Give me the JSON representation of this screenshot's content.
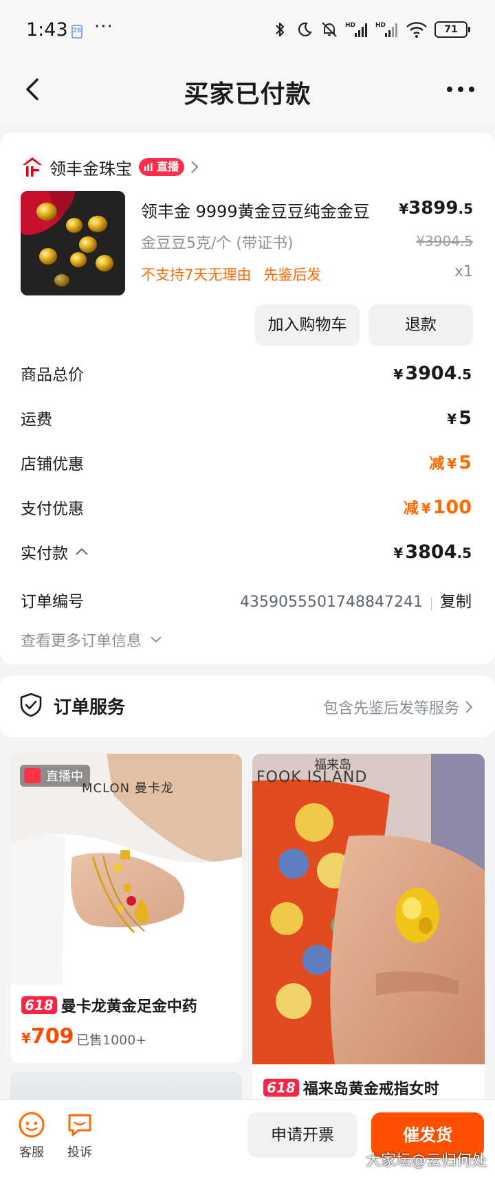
{
  "status_bar": {
    "time": "1:43",
    "calendar_day": "28",
    "dots": "···",
    "battery": "71",
    "hd1": "HD",
    "hd2": "HD"
  },
  "header": {
    "title": "买家已付款"
  },
  "shop": {
    "name": "领丰金珠宝",
    "live_label": "直播"
  },
  "product": {
    "title": "领丰金 9999黄金豆豆纯金金豆",
    "price_currency": "¥",
    "price_int": "3899",
    "price_dec": ".5",
    "spec": "金豆豆5克/个 (带证书)",
    "original_price": "¥3904.5",
    "tags": [
      "不支持7天无理由",
      "先鉴后发"
    ],
    "qty": "x1",
    "add_cart_label": "加入购物车",
    "refund_label": "退款"
  },
  "summary": {
    "total_label": "商品总价",
    "total_cur": "¥",
    "total_int": "3904",
    "total_dec": ".5",
    "shipping_label": "运费",
    "shipping_cur": "¥",
    "shipping_val": "5",
    "shop_discount_label": "店铺优惠",
    "shop_discount_prefix": "减",
    "shop_discount_cur": "¥",
    "shop_discount_val": "5",
    "pay_discount_label": "支付优惠",
    "pay_discount_prefix": "减",
    "pay_discount_cur": "¥",
    "pay_discount_val": "100",
    "paid_label": "实付款",
    "paid_cur": "¥",
    "paid_int": "3804",
    "paid_dec": ".5",
    "order_no_label": "订单编号",
    "order_no": "4359055501748847241",
    "copy_label": "复制",
    "more_info_label": "查看更多订单信息"
  },
  "service": {
    "title": "订单服务",
    "desc": "包含先鉴后发等服务"
  },
  "recommendations": [
    {
      "live_label": "直播中",
      "brand_overlay": "MCLON 曼卡龙",
      "tag": "618",
      "title": "曼卡龙黄金足金中药",
      "price_cur": "¥",
      "price": "709",
      "sold": "已售1000+"
    },
    {
      "brand_overlay": "FOOK ISLAND",
      "brand_overlay_cn": "福来岛",
      "tag": "618",
      "title": "福来岛黄金戒指女时"
    }
  ],
  "bottom_bar": {
    "kefu_label": "客服",
    "complain_label": "投诉",
    "invoice_label": "申请开票",
    "urge_label": "催发货",
    "watermark": "大家坛@云归何处"
  },
  "colors": {
    "accent_orange": "#ff6a00",
    "urge_button": "#ff5000",
    "live_red": "#ff2e4d",
    "shop_logo_red": "#e60012"
  }
}
